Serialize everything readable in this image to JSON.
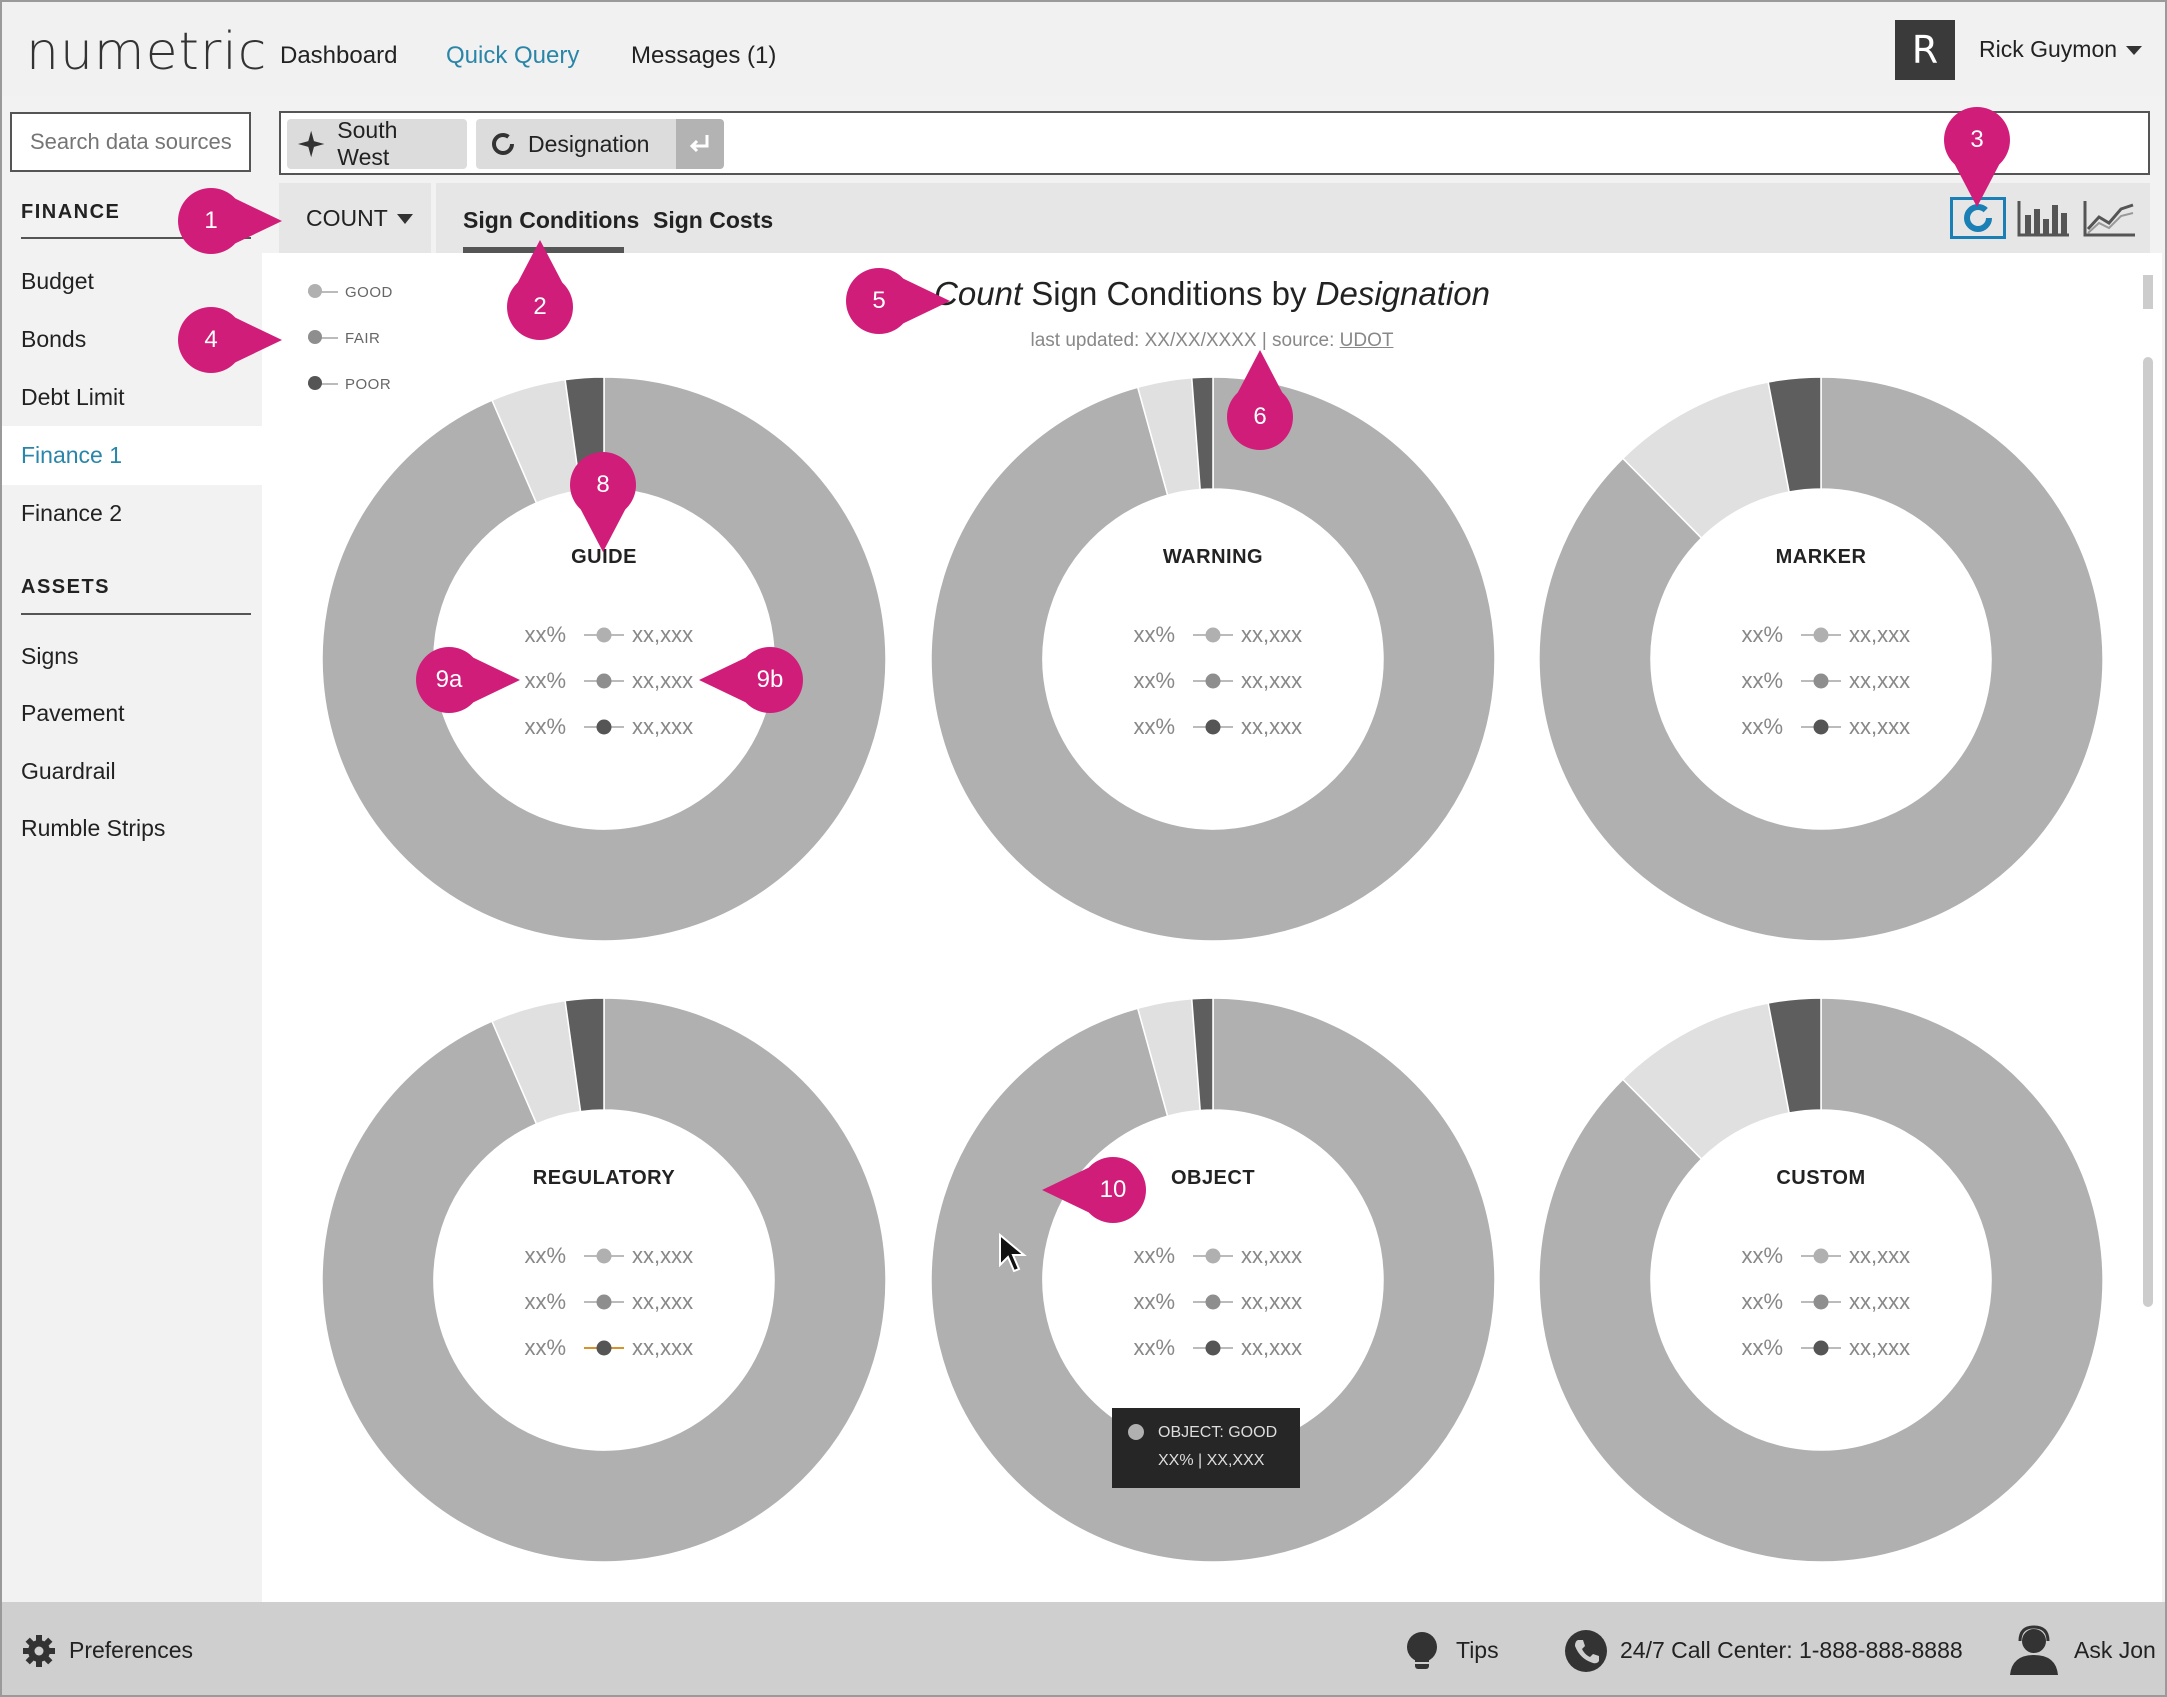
{
  "app": {
    "logo": "numetric"
  },
  "nav": {
    "dashboard": "Dashboard",
    "quick_query": "Quick Query",
    "messages": "Messages (1)",
    "avatar_initial": "R",
    "user_name": "Rick Guymon"
  },
  "sidebar": {
    "search_placeholder": "Search data sources",
    "sections": [
      {
        "heading": "FINANCE",
        "items": [
          "Budget",
          "Bonds",
          "Debt Limit",
          "Finance 1",
          "Finance 2"
        ]
      },
      {
        "heading": "ASSETS",
        "items": [
          "Signs",
          "Pavement",
          "Guardrail",
          "Rumble Strips"
        ]
      }
    ],
    "active_item": "Finance 1"
  },
  "query": {
    "chips": [
      "South West",
      "Designation"
    ]
  },
  "toolbar": {
    "measure": "COUNT",
    "tabs": [
      "Sign Conditions",
      "Sign Costs"
    ],
    "active_tab": "Sign Conditions",
    "view_modes": [
      "donut-icon",
      "bar-chart-icon",
      "line-chart-icon"
    ],
    "active_view": "donut-icon"
  },
  "chart_header": {
    "measure_italic": "Count",
    "middle": "Sign Conditions by",
    "dimension_italic": "Designation",
    "last_updated": "last updated: XX/XX/XXXX",
    "source_label": "| source:",
    "source_link": "UDOT"
  },
  "legend": [
    {
      "label": "GOOD",
      "color": "#b0b0b0"
    },
    {
      "label": "FAIR",
      "color": "#8e8e8e"
    },
    {
      "label": "POOR",
      "color": "#555555"
    }
  ],
  "chart_data": {
    "type": "donut",
    "title": "Count Sign Conditions by Designation",
    "series_colors": {
      "GOOD": "#b0b0b0",
      "FAIR": "#e0e0e0",
      "POOR": "#5e5e5e"
    },
    "charts": [
      {
        "name": "GUIDE",
        "good": 93.5,
        "fair": 4.3,
        "poor": 2.2,
        "rows": [
          [
            "xx%",
            "xx,xxx"
          ],
          [
            "xx%",
            "xx,xxx"
          ],
          [
            "xx%",
            "xx,xxx"
          ]
        ]
      },
      {
        "name": "WARNING",
        "good": 95.7,
        "fair": 3.1,
        "poor": 1.2,
        "rows": [
          [
            "xx%",
            "xx,xxx"
          ],
          [
            "xx%",
            "xx,xxx"
          ],
          [
            "xx%",
            "xx,xxx"
          ]
        ]
      },
      {
        "name": "MARKER",
        "good": 87.6,
        "fair": 9.4,
        "poor": 3.0,
        "rows": [
          [
            "xx%",
            "xx,xxx"
          ],
          [
            "xx%",
            "xx,xxx"
          ],
          [
            "xx%",
            "xx,xxx"
          ]
        ]
      },
      {
        "name": "REGULATORY",
        "good": 93.5,
        "fair": 4.3,
        "poor": 2.2,
        "rows": [
          [
            "xx%",
            "xx,xxx"
          ],
          [
            "xx%",
            "xx,xxx"
          ],
          [
            "xx%",
            "xx,xxx"
          ]
        ]
      },
      {
        "name": "OBJECT",
        "good": 95.7,
        "fair": 3.1,
        "poor": 1.2,
        "rows": [
          [
            "xx%",
            "xx,xxx"
          ],
          [
            "xx%",
            "xx,xxx"
          ],
          [
            "xx%",
            "xx,xxx"
          ]
        ]
      },
      {
        "name": "CUSTOM",
        "good": 87.6,
        "fair": 9.4,
        "poor": 3.0,
        "rows": [
          [
            "xx%",
            "xx,xxx"
          ],
          [
            "xx%",
            "xx,xxx"
          ],
          [
            "xx%",
            "xx,xxx"
          ]
        ]
      }
    ]
  },
  "tooltip": {
    "line1": "OBJECT: GOOD",
    "line2": "XX%  |   XX,XXX"
  },
  "callouts": [
    "1",
    "2",
    "3",
    "4",
    "5",
    "6",
    "8",
    "9a",
    "9b",
    "10"
  ],
  "footer": {
    "preferences": "Preferences",
    "tips": "Tips",
    "call_center": "24/7 Call Center: 1-888-888-8888",
    "ask": "Ask Jon"
  }
}
